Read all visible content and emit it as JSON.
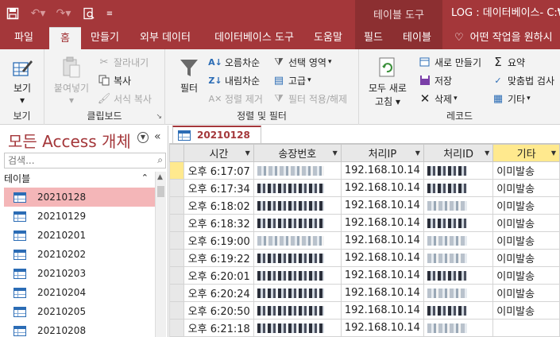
{
  "window": {
    "context_tab_title": "테이블 도구",
    "title": "LOG : 데이터베이스- C:₩"
  },
  "qat": {
    "save_icon": "save-icon",
    "undo_icon": "undo-icon",
    "redo_icon": "redo-icon",
    "preview_icon": "print-preview-icon",
    "customize_icon": "customize-qat-icon"
  },
  "ribbon_tabs": [
    {
      "label": "파일"
    },
    {
      "label": "홈"
    },
    {
      "label": "만들기"
    },
    {
      "label": "외부 데이터"
    },
    {
      "label": "데이터베이스 도구"
    },
    {
      "label": "도움말"
    },
    {
      "label": "필드"
    },
    {
      "label": "테이블"
    }
  ],
  "tell_me": "어떤 작업을 원하시",
  "ribbon": {
    "view": {
      "label": "보기",
      "sub": "보기",
      "group": "보기"
    },
    "clipboard": {
      "paste": "붙여넣기",
      "cut": "잘라내기",
      "copy": "복사",
      "format_painter": "서식 복사",
      "group": "클립보드"
    },
    "sort_filter": {
      "filter": "필터",
      "ascending": "오름차순",
      "descending": "내림차순",
      "remove_sort": "정렬 제거",
      "selection": "선택 영역",
      "advanced": "고급",
      "toggle_filter": "필터 적용/해제",
      "group": "정렬 및 필터"
    },
    "records": {
      "refresh_all": "모두 새로",
      "refresh_all_2": "고침",
      "new": "새로 만들기",
      "save": "저장",
      "delete": "삭제",
      "totals": "요약",
      "spelling": "맞춤법 검사",
      "more": "기타",
      "group": "레코드"
    }
  },
  "nav": {
    "title": "모든 Access 개체",
    "search_placeholder": "검색...",
    "section": "테이블",
    "items": [
      "20210128",
      "20210129",
      "20210201",
      "20210202",
      "20210203",
      "20210204",
      "20210205",
      "20210208"
    ],
    "selected_index": 0
  },
  "document": {
    "tab_label": "20210128",
    "columns": [
      "시간",
      "송장번호",
      "처리IP",
      "처리ID",
      "기타"
    ],
    "rows": [
      {
        "time": "오후 6:17:07",
        "ip": "192.168.10.14",
        "etc": "이미발송"
      },
      {
        "time": "오후 6:17:34",
        "ip": "192.168.10.14",
        "etc": "이미발송"
      },
      {
        "time": "오후 6:18:02",
        "ip": "192.168.10.14",
        "etc": "이미발송"
      },
      {
        "time": "오후 6:18:32",
        "ip": "192.168.10.14",
        "etc": "이미발송"
      },
      {
        "time": "오후 6:19:00",
        "ip": "192.168.10.14",
        "etc": "이미발송"
      },
      {
        "time": "오후 6:19:22",
        "ip": "192.168.10.14",
        "etc": "이미발송"
      },
      {
        "time": "오후 6:20:01",
        "ip": "192.168.10.14",
        "etc": "이미발송"
      },
      {
        "time": "오후 6:20:24",
        "ip": "192.168.10.14",
        "etc": "이미발송"
      },
      {
        "time": "오후 6:20:50",
        "ip": "192.168.10.14",
        "etc": "이미발송"
      },
      {
        "time": "오후 6:21:18",
        "ip": "192.168.10.14",
        "etc": ""
      }
    ]
  },
  "colors": {
    "access_red": "#a4373a",
    "context_tab": "#8c2f31",
    "selected_nav": "#f4b6b8",
    "highlight_header": "#ffe98e"
  }
}
